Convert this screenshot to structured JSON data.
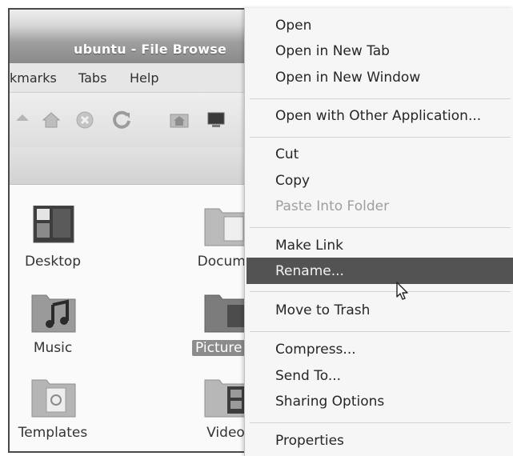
{
  "window": {
    "title": "ubuntu - File Browse"
  },
  "menubar": {
    "items": [
      "kmarks",
      "Tabs",
      "Help"
    ]
  },
  "toolbar": {
    "icons": [
      "up-arrow-icon",
      "home-icon",
      "stop-icon",
      "reload-icon",
      "home-folder-icon",
      "computer-icon"
    ]
  },
  "files": [
    {
      "label": "Desktop",
      "icon": "desktop-folder-icon"
    },
    {
      "label": "Docume",
      "icon": "documents-folder-icon"
    },
    {
      "label": "Music",
      "icon": "music-folder-icon"
    },
    {
      "label": "Picture",
      "icon": "pictures-folder-icon",
      "selected": true
    },
    {
      "label": "Templates",
      "icon": "templates-folder-icon"
    },
    {
      "label": "Video",
      "icon": "videos-folder-icon"
    }
  ],
  "context_menu": {
    "items": [
      {
        "label": "Open",
        "enabled": true
      },
      {
        "label": "Open in New Tab",
        "enabled": true
      },
      {
        "label": "Open in New Window",
        "enabled": true
      },
      {
        "label": "Open with Other Application...",
        "enabled": true
      },
      {
        "label": "Cut",
        "enabled": true
      },
      {
        "label": "Copy",
        "enabled": true
      },
      {
        "label": "Paste Into Folder",
        "enabled": false
      },
      {
        "label": "Make Link",
        "enabled": true
      },
      {
        "label": "Rename...",
        "enabled": true,
        "highlighted": true
      },
      {
        "label": "Move to Trash",
        "enabled": true
      },
      {
        "label": "Compress...",
        "enabled": true
      },
      {
        "label": "Send To...",
        "enabled": true
      },
      {
        "label": "Sharing Options",
        "enabled": true
      },
      {
        "label": "Properties",
        "enabled": true
      }
    ]
  },
  "colors": {
    "highlight": "#535353",
    "selection": "#8c8c8c"
  }
}
